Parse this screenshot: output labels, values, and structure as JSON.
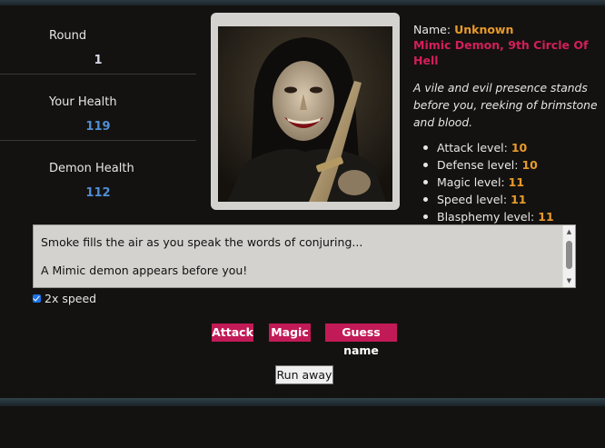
{
  "stats": {
    "round_label": "Round",
    "round_value": "1",
    "your_health_label": "Your Health",
    "your_health_value": "119",
    "demon_health_label": "Demon Health",
    "demon_health_value": "112",
    "round_color": "#d6dbe6",
    "health_color": "#4d8fd6"
  },
  "demon": {
    "name_label": "Name:",
    "name_value": "Unknown",
    "title": "Mimic Demon, 9th Circle Of Hell",
    "description": "A vile and evil presence stands before you, reeking of brimstone and blood.",
    "levels": [
      {
        "label": "Attack level:",
        "value": "10"
      },
      {
        "label": "Defense level:",
        "value": "10"
      },
      {
        "label": "Magic level:",
        "value": "11"
      },
      {
        "label": "Speed level:",
        "value": "11"
      },
      {
        "label": "Blasphemy level:",
        "value": "11"
      }
    ]
  },
  "log": [
    "Smoke fills the air as you speak the words of conjuring...",
    "A Mimic demon appears before you!"
  ],
  "speed": {
    "label": "2x speed",
    "checked": true
  },
  "actions": {
    "attack": "Attack",
    "magic": "Magic",
    "guess_name": "Guess name",
    "run_away": "Run away"
  },
  "colors": {
    "accent": "#c21a57",
    "name_value": "#e89a2c",
    "title": "#d31f5a",
    "background": "#141210"
  }
}
